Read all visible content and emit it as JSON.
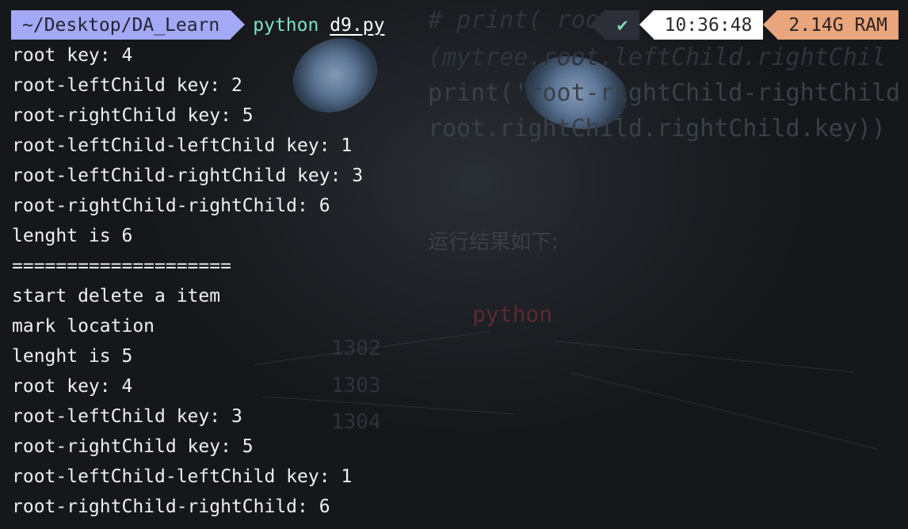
{
  "prompt": {
    "cwd": "~/Desktop/DA_Learn",
    "command": "python",
    "argument": "d9.py",
    "status_icon": "check-icon",
    "status_glyph": "✔",
    "time": "10:36:48",
    "ram": "2.14G RAM"
  },
  "output": [
    "root key: 4",
    "root-leftChild key: 2",
    "root-rightChild key: 5",
    "root-leftChild-leftChild key: 1",
    "root-leftChild-rightChild key: 3",
    "root-rightChild-rightChild: 6",
    "lenght is 6",
    "====================",
    "start delete a item",
    "mark location",
    "lenght is 5",
    "root key: 4",
    "root-leftChild key: 3",
    "root-rightChild key: 5",
    "root-leftChild-leftChild key: 1",
    "root-rightChild-rightChild: 6"
  ],
  "wallpaper": {
    "code_lines": [
      "# print( roo",
      "(mytree.root.leftChild.rightChil",
      "print('root-rightChild-rightChild",
      "root.rightChild.rightChild.key))"
    ],
    "note": "运行结果如下:",
    "lang_label": "python",
    "line_numbers": [
      "1302",
      "1303",
      "1304"
    ]
  },
  "colors": {
    "dir_segment_bg": "#a4a9f6",
    "command_color": "#7ee0c6",
    "status_color": "#7fd9b0",
    "time_bg": "#ffffff",
    "ram_bg": "#e9a57c"
  }
}
